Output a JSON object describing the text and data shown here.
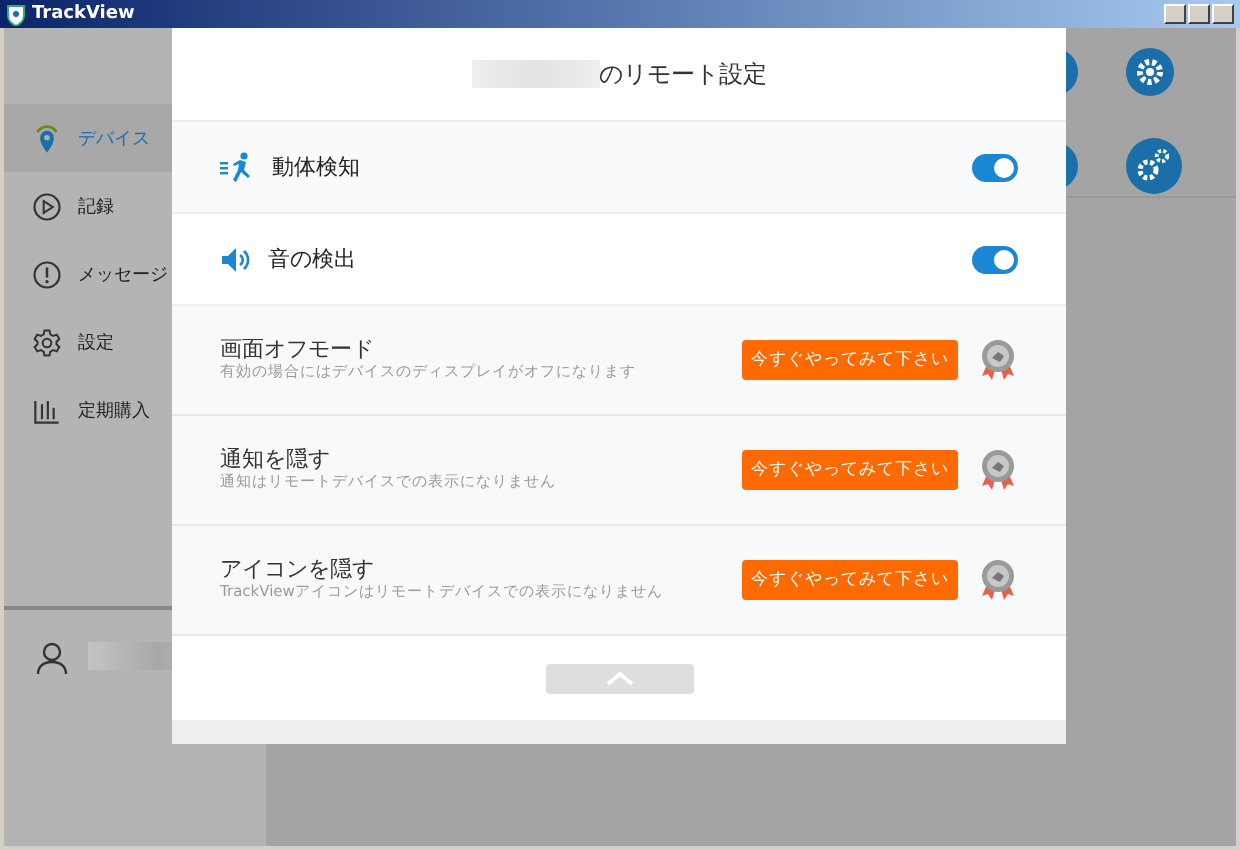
{
  "window": {
    "title": "TrackView"
  },
  "sidebar": {
    "items": [
      {
        "label": "デバイス",
        "selected": true
      },
      {
        "label": "記録",
        "selected": false
      },
      {
        "label": "メッセージ",
        "selected": false
      },
      {
        "label": "設定",
        "selected": false
      },
      {
        "label": "定期購入",
        "selected": false
      }
    ]
  },
  "dialog": {
    "title": "のリモート設定",
    "toggles": [
      {
        "label": "動体検知",
        "on": true
      },
      {
        "label": "音の検出",
        "on": true
      }
    ],
    "features": [
      {
        "title": "画面オフモード",
        "description": "有効の場合にはデバイスのディスプレイがオフになります",
        "button": "今すぐやってみて下さい"
      },
      {
        "title": "通知を隠す",
        "description": "通知はリモートデバイスでの表示になりません",
        "button": "今すぐやってみて下さい"
      },
      {
        "title": "アイコンを隠す",
        "description": "TrackViewアイコンはリモートデバイスでの表示になりません",
        "button": "今すぐやってみて下さい"
      }
    ]
  }
}
